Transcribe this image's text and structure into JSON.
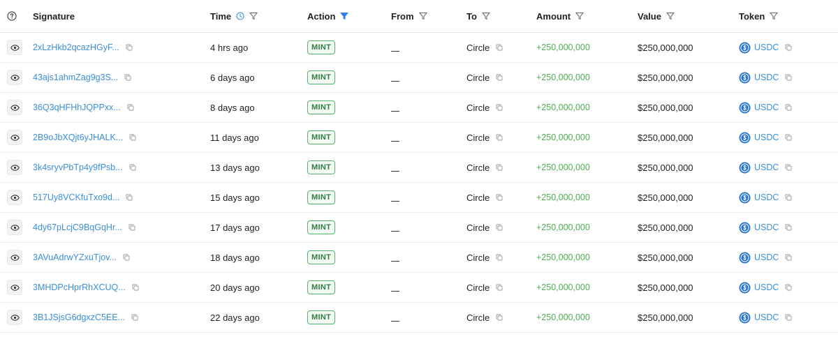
{
  "header": {
    "help_icon": "question-circle-icon",
    "signature": "Signature",
    "time": "Time",
    "action": "Action",
    "from": "From",
    "to": "To",
    "amount": "Amount",
    "value": "Value",
    "token": "Token"
  },
  "colors": {
    "link": "#3a8fd8",
    "positive": "#4caf50",
    "badge_border": "#52b46a",
    "active_filter": "#2f80ed"
  },
  "rows": [
    {
      "signature": "2xLzHkb2qcazHGyF...",
      "time": "4 hrs ago",
      "action": "MINT",
      "from": "",
      "to": "Circle",
      "amount": "+250,000,000",
      "value": "$250,000,000",
      "token": "USDC"
    },
    {
      "signature": "43ajs1ahmZag9g3S...",
      "time": "6 days ago",
      "action": "MINT",
      "from": "",
      "to": "Circle",
      "amount": "+250,000,000",
      "value": "$250,000,000",
      "token": "USDC"
    },
    {
      "signature": "36Q3qHFHhJQPPxx...",
      "time": "8 days ago",
      "action": "MINT",
      "from": "",
      "to": "Circle",
      "amount": "+250,000,000",
      "value": "$250,000,000",
      "token": "USDC"
    },
    {
      "signature": "2B9oJbXQjt6yJHALK...",
      "time": "11 days ago",
      "action": "MINT",
      "from": "",
      "to": "Circle",
      "amount": "+250,000,000",
      "value": "$250,000,000",
      "token": "USDC"
    },
    {
      "signature": "3k4sryvPbTp4y9fPsb...",
      "time": "13 days ago",
      "action": "MINT",
      "from": "",
      "to": "Circle",
      "amount": "+250,000,000",
      "value": "$250,000,000",
      "token": "USDC"
    },
    {
      "signature": "517Uy8VCKfuTxo9d...",
      "time": "15 days ago",
      "action": "MINT",
      "from": "",
      "to": "Circle",
      "amount": "+250,000,000",
      "value": "$250,000,000",
      "token": "USDC"
    },
    {
      "signature": "4dy67pLcjC9BqGqHr...",
      "time": "17 days ago",
      "action": "MINT",
      "from": "",
      "to": "Circle",
      "amount": "+250,000,000",
      "value": "$250,000,000",
      "token": "USDC"
    },
    {
      "signature": "3AVuAdrwYZxuTjov...",
      "time": "18 days ago",
      "action": "MINT",
      "from": "",
      "to": "Circle",
      "amount": "+250,000,000",
      "value": "$250,000,000",
      "token": "USDC"
    },
    {
      "signature": "3MHDPcHprRhXCUQ...",
      "time": "20 days ago",
      "action": "MINT",
      "from": "",
      "to": "Circle",
      "amount": "+250,000,000",
      "value": "$250,000,000",
      "token": "USDC"
    },
    {
      "signature": "3B1JSjsG6dgxzC5EE...",
      "time": "22 days ago",
      "action": "MINT",
      "from": "",
      "to": "Circle",
      "amount": "+250,000,000",
      "value": "$250,000,000",
      "token": "USDC"
    }
  ]
}
